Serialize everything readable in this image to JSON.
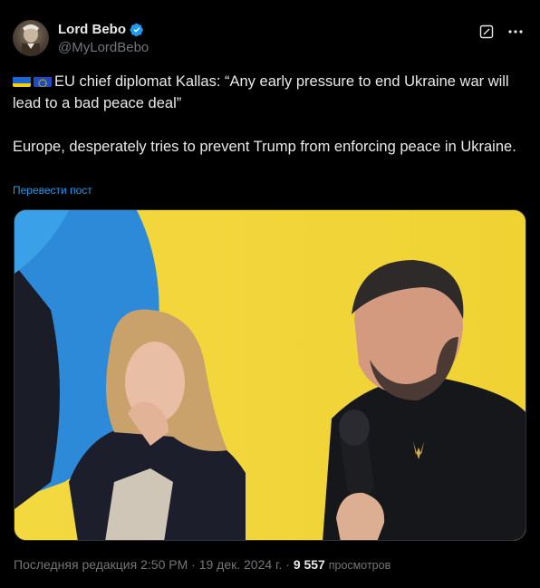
{
  "author": {
    "display_name": "Lord Bebo",
    "handle": "@MyLordBebo",
    "avatar_icon": "avatar-image"
  },
  "icons": {
    "verified": "verified-badge-icon",
    "edit": "edit-history-icon",
    "more": "more-options-icon"
  },
  "tweet": {
    "line1": "EU chief diplomat Kallas: “Any early pressure to end Ukraine war will lead to a bad peace deal”",
    "line2": "Europe, desperately tries to prevent Trump from enforcing peace in Ukraine.",
    "flags": [
      "🇺🇦",
      "🇪🇺"
    ]
  },
  "translate_label": "Перевести пост",
  "footer": {
    "edited_prefix": "Последняя редакция",
    "time": "2:50 PM",
    "separator": "·",
    "date": "19 дек. 2024 г.",
    "views_count": "9 557",
    "views_label": "просмотров"
  },
  "colors": {
    "background": "#000000",
    "text": "#e7e9ea",
    "muted": "#71767b",
    "accent": "#1d9bf0",
    "photo_background": "#f2d635"
  }
}
